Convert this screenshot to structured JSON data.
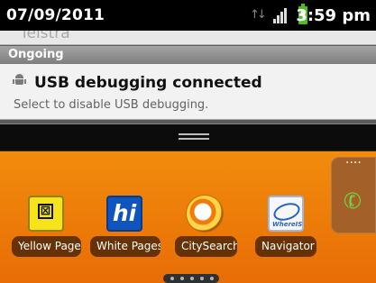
{
  "status_bar": {
    "date": "07/09/2011",
    "time": "3:59 pm",
    "icons": {
      "data": "data-transfer-icon",
      "signal": "signal-strength-icon",
      "battery": "charging-battery-icon"
    }
  },
  "notification_shade": {
    "carrier": "Telstra",
    "section": "Ongoing",
    "notification": {
      "icon": "android-debug-icon",
      "title": "USB debugging connected",
      "text": "Select to disable USB debugging."
    },
    "handle_icon": "drag-handle-icon"
  },
  "home_screen": {
    "apps": [
      {
        "label": "Yellow Pages",
        "icon": "yellow-pages-icon",
        "icon_text": "⊠"
      },
      {
        "label": "White Pages",
        "icon": "white-pages-icon",
        "icon_text": "hi"
      },
      {
        "label": "CitySearch",
        "icon": "citysearch-icon"
      },
      {
        "label": "Navigator",
        "icon": "navigator-icon",
        "icon_text": "WhereIS"
      }
    ],
    "dock_icon": "phone-icon",
    "page_indicator_icon": "page-dots-icon"
  },
  "colors": {
    "status_bar": "#000000",
    "home_background": "#f07c0a",
    "notification_background": "#f2f2f2",
    "battery": "#4fbf1f",
    "phone_icon": "#74d344"
  }
}
